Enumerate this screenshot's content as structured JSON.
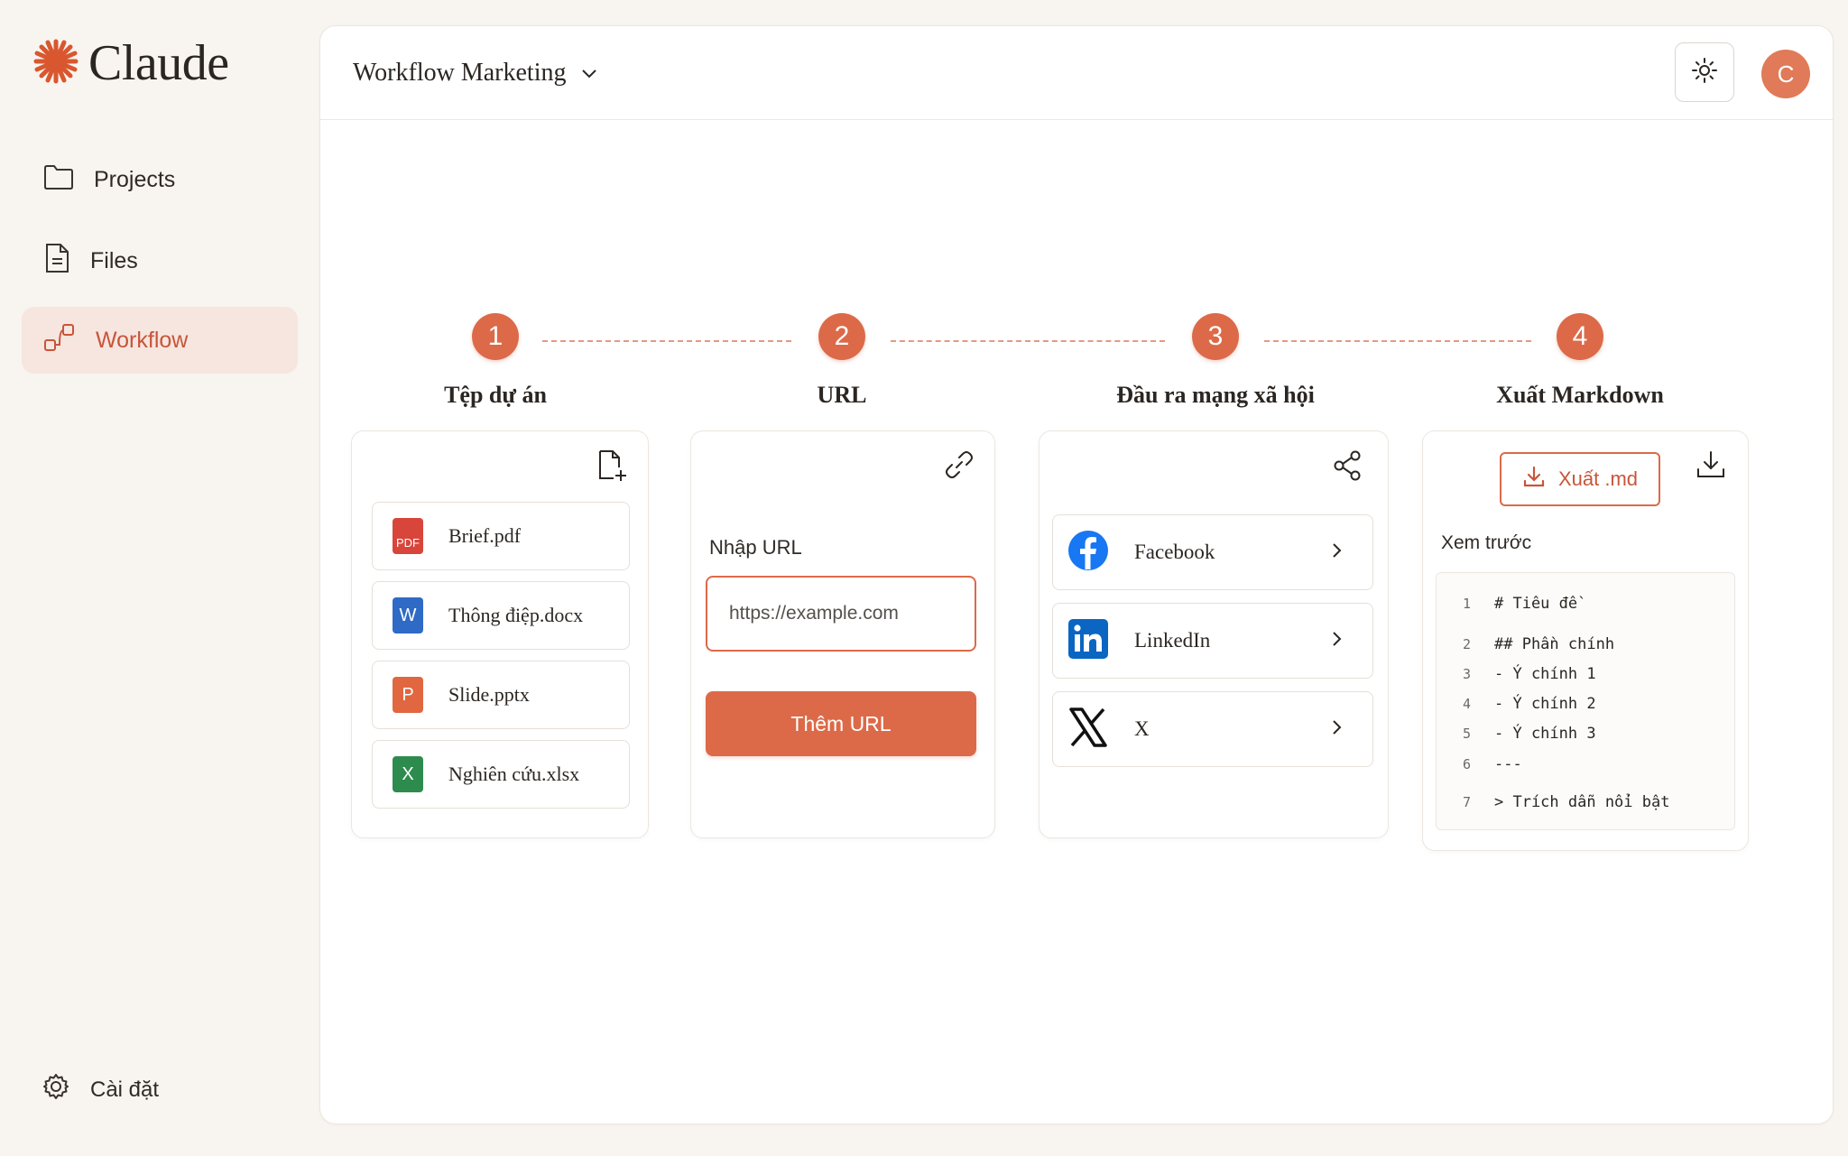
{
  "app": {
    "name": "Claude"
  },
  "sidebar": {
    "items": [
      {
        "label": "Projects"
      },
      {
        "label": "Files"
      },
      {
        "label": "Workflow"
      }
    ],
    "settings_label": "Cài đặt"
  },
  "header": {
    "project_name": "Workflow Marketing",
    "avatar_initial": "C"
  },
  "steps": [
    {
      "number": "1",
      "title": "Tệp dự án"
    },
    {
      "number": "2",
      "title": "URL"
    },
    {
      "number": "3",
      "title": "Đầu ra mạng xã hội"
    },
    {
      "number": "4",
      "title": "Xuất Markdown"
    }
  ],
  "files": [
    {
      "name": "Brief.pdf",
      "type": "PDF",
      "icon": "pdf-file-icon"
    },
    {
      "name": "Thông điệp.docx",
      "type": "W",
      "icon": "word-file-icon"
    },
    {
      "name": "Slide.pptx",
      "type": "P",
      "icon": "powerpoint-file-icon"
    },
    {
      "name": "Nghiên cứu.xlsx",
      "type": "X",
      "icon": "excel-file-icon"
    }
  ],
  "url": {
    "label": "Nhập URL",
    "placeholder": "https://example.com",
    "button_label": "Thêm URL"
  },
  "social": [
    {
      "name": "Facebook",
      "icon": "facebook-icon"
    },
    {
      "name": "LinkedIn",
      "icon": "linkedin-icon"
    },
    {
      "name": "X",
      "icon": "x-icon"
    }
  ],
  "export": {
    "button_label": "Xuất .md",
    "preview_label": "Xem trước",
    "lines": [
      {
        "n": "1",
        "text": "# Tiêu đề"
      },
      {
        "n": "2",
        "text": "## Phần chính"
      },
      {
        "n": "3",
        "text": "- Ý chính 1"
      },
      {
        "n": "4",
        "text": "- Ý chính 2"
      },
      {
        "n": "5",
        "text": "- Ý chính 3"
      },
      {
        "n": "6",
        "text": "---"
      },
      {
        "n": "7",
        "text": "> Trích dẫn nổi bật"
      }
    ]
  },
  "colors": {
    "accent": "#dc6a48",
    "accent_text": "#c8553a",
    "active_nav_bg": "#f6e6df",
    "background": "#f8f4ef"
  }
}
